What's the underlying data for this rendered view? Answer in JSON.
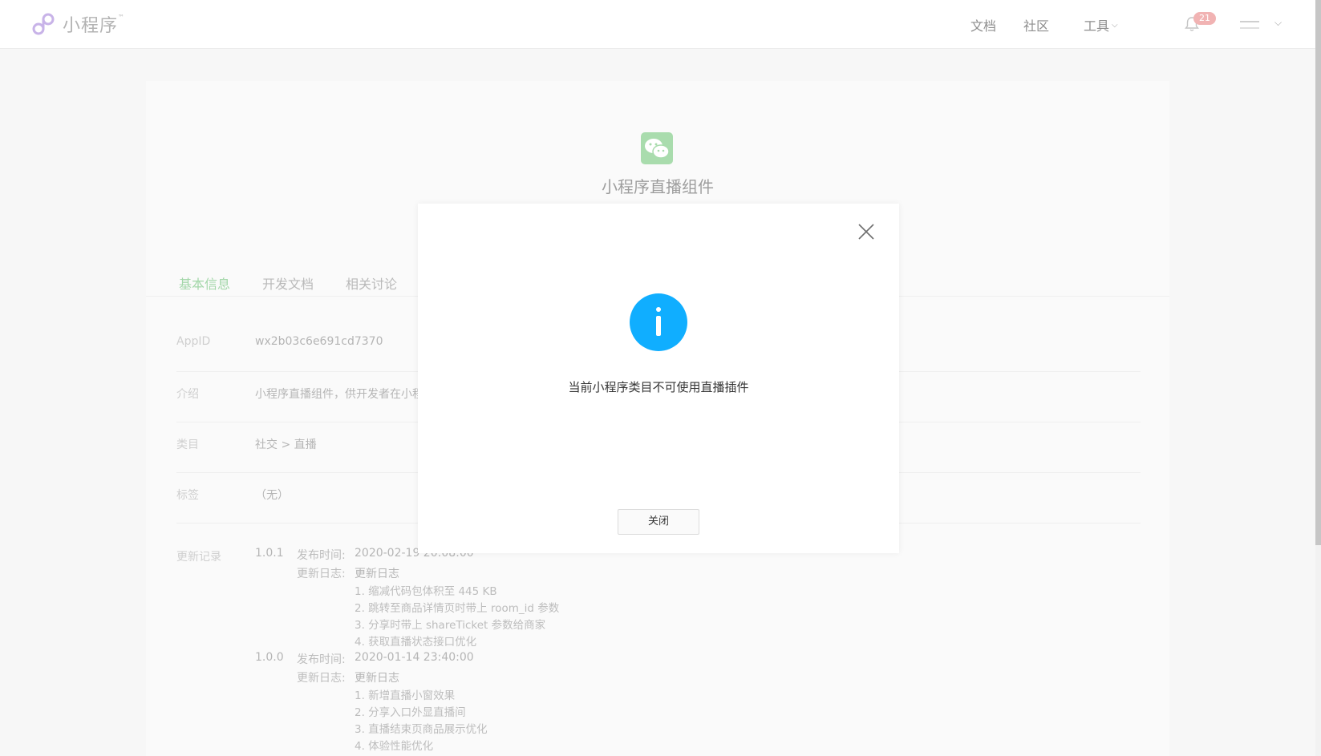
{
  "header": {
    "logo_text": "小程序",
    "logo_tm": "™",
    "nav": [
      {
        "label": "文档"
      },
      {
        "label": "社区"
      },
      {
        "label": "工具"
      }
    ],
    "notification_count": "21",
    "user_name": ""
  },
  "plugin": {
    "title": "小程序直播组件",
    "icon": "wechat-icon",
    "icon_color": "#a9dcad"
  },
  "tabs": [
    {
      "label": "基本信息",
      "active": true
    },
    {
      "label": "开发文档",
      "active": false
    },
    {
      "label": "相关讨论",
      "active": false
    }
  ],
  "info": {
    "appid_label": "AppID",
    "appid_value": "wx2b03c6e691cd7370",
    "intro_label": "介绍",
    "intro_value": "小程序直播组件，供开发者在小程",
    "category_label": "类目",
    "category_value": "社交 > 直播",
    "tags_label": "标签",
    "tags_value": "（无）"
  },
  "changelog": {
    "label": "更新记录",
    "versions": [
      {
        "version": "1.0.1",
        "time_label": "发布时间:",
        "time_value": "2020-02-19 20:08:00",
        "log_label": "更新日志:",
        "log_title": "更新日志",
        "items": [
          "1. 缩减代码包体积至 445 KB",
          "2. 跳转至商品详情页时带上 room_id 参数",
          "3. 分享时带上 shareTicket 参数给商家",
          "4. 获取直播状态接口优化"
        ]
      },
      {
        "version": "1.0.0",
        "time_label": "发布时间:",
        "time_value": "2020-01-14 23:40:00",
        "log_label": "更新日志:",
        "log_title": "更新日志",
        "items": [
          "1. 新增直播小窗效果",
          "2. 分享入口外显直播间",
          "3. 直播结束页商品展示优化",
          "4. 体验性能优化"
        ]
      }
    ]
  },
  "modal": {
    "icon": "info-icon",
    "icon_color": "#10aeff",
    "message": "当前小程序类目不可使用直播插件",
    "close_button": "关闭"
  },
  "colors": {
    "accent_green": "#a3d7a9",
    "badge": "#f1b3b3"
  }
}
